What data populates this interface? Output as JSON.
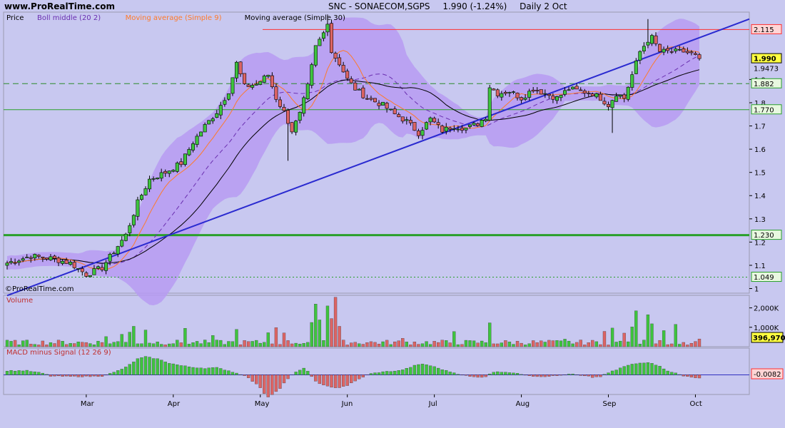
{
  "header": {
    "site": "www.ProRealTime.com",
    "symbol": "SNC - SONAECOM,SGPS",
    "quote": "1.990 (-1.24%)",
    "period": "Daily  2 Oct"
  },
  "colors": {
    "background": "#c8c8f0",
    "band": "#b79bf2",
    "up": "#3ec43e",
    "down": "#dc6464",
    "ma9": "#ff7a2a",
    "ma30": "#000000",
    "boll": "#6a2fb0",
    "trend": "#2a2ad0",
    "resistance": "#ff3030",
    "support": "#2aa02a"
  },
  "chart_data": [
    {
      "type": "candlestick",
      "legend": [
        {
          "name": "Price",
          "color": "#000000"
        },
        {
          "name": "Boll middle (20 2)",
          "color": "#6a2fb0"
        },
        {
          "name": "Moving average (Simple 9)",
          "color": "#ff7a2a"
        },
        {
          "name": "Moving average (Simple 30)",
          "color": "#000000"
        }
      ],
      "ylim": [
        0.98,
        2.19
      ],
      "y_ticks": [
        1,
        1.1,
        1.2,
        1.3,
        1.4,
        1.5,
        1.6,
        1.7,
        1.8,
        1.9
      ],
      "price_labels": [
        {
          "text": "2.115",
          "value": 2.115,
          "style": "resistance"
        },
        {
          "text": "1.990",
          "value": 1.99,
          "style": "current"
        },
        {
          "text": "1.9473",
          "value": 1.9473,
          "style": "plain"
        },
        {
          "text": "1.882",
          "value": 1.882,
          "style": "support"
        },
        {
          "text": "1.770",
          "value": 1.77,
          "style": "support"
        },
        {
          "text": "1.230",
          "value": 1.23,
          "style": "support"
        },
        {
          "text": "1.049",
          "value": 1.049,
          "style": "support"
        }
      ],
      "horizontal_lines": [
        {
          "value": 2.115,
          "kind": "solid-red"
        },
        {
          "value": 1.882,
          "kind": "dashed-green"
        },
        {
          "value": 1.77,
          "kind": "solid-green-thin"
        },
        {
          "value": 1.23,
          "kind": "solid-green-thick"
        },
        {
          "value": 1.049,
          "kind": "dotted-green"
        }
      ],
      "trendline": {
        "from": {
          "x": 0,
          "y": 0.97
        },
        "to": {
          "x": 175,
          "y": 2.08
        }
      },
      "months": [
        {
          "label": "Mar",
          "x": 20
        },
        {
          "label": "Apr",
          "x": 42
        },
        {
          "label": "May",
          "x": 64
        },
        {
          "label": "Jun",
          "x": 86
        },
        {
          "label": "Jul",
          "x": 108
        },
        {
          "label": "Aug",
          "x": 130
        },
        {
          "label": "Sep",
          "x": 152
        },
        {
          "label": "Oct",
          "x": 174
        }
      ],
      "close_anchors": [
        [
          0,
          1.11
        ],
        [
          6,
          1.14
        ],
        [
          11,
          1.13
        ],
        [
          16,
          1.11
        ],
        [
          20,
          1.06
        ],
        [
          24,
          1.09
        ],
        [
          27,
          1.16
        ],
        [
          30,
          1.23
        ],
        [
          33,
          1.37
        ],
        [
          36,
          1.47
        ],
        [
          40,
          1.5
        ],
        [
          44,
          1.54
        ],
        [
          47,
          1.63
        ],
        [
          50,
          1.7
        ],
        [
          53,
          1.76
        ],
        [
          56,
          1.85
        ],
        [
          58,
          1.97
        ],
        [
          60,
          1.87
        ],
        [
          63,
          1.88
        ],
        [
          66,
          1.92
        ],
        [
          68,
          1.82
        ],
        [
          70,
          1.76
        ],
        [
          72,
          1.68
        ],
        [
          74,
          1.75
        ],
        [
          76,
          1.87
        ],
        [
          78,
          2.04
        ],
        [
          80,
          2.1
        ],
        [
          81,
          2.15
        ],
        [
          82,
          2.02
        ],
        [
          84,
          1.97
        ],
        [
          86,
          1.9
        ],
        [
          88,
          1.86
        ],
        [
          91,
          1.82
        ],
        [
          95,
          1.79
        ],
        [
          98,
          1.75
        ],
        [
          101,
          1.72
        ],
        [
          104,
          1.67
        ],
        [
          107,
          1.73
        ],
        [
          110,
          1.68
        ],
        [
          113,
          1.7
        ],
        [
          116,
          1.69
        ],
        [
          119,
          1.71
        ],
        [
          121,
          1.74
        ],
        [
          122,
          1.87
        ],
        [
          124,
          1.84
        ],
        [
          127,
          1.85
        ],
        [
          130,
          1.82
        ],
        [
          133,
          1.86
        ],
        [
          136,
          1.84
        ],
        [
          139,
          1.82
        ],
        [
          142,
          1.86
        ],
        [
          145,
          1.85
        ],
        [
          148,
          1.84
        ],
        [
          150,
          1.82
        ],
        [
          152,
          1.79
        ],
        [
          154,
          1.84
        ],
        [
          156,
          1.82
        ],
        [
          158,
          1.92
        ],
        [
          160,
          2.02
        ],
        [
          162,
          2.07
        ],
        [
          163,
          2.08
        ],
        [
          165,
          2.02
        ],
        [
          168,
          2.02
        ],
        [
          171,
          2.02
        ],
        [
          173,
          2.01
        ],
        [
          175,
          1.99
        ]
      ],
      "volume": {
        "label": "Volume",
        "ticks": [
          {
            "text": "2,000K",
            "value": 2000
          },
          {
            "text": "1,000K",
            "value": 1000
          }
        ],
        "last_label": "396,970",
        "ymax": 2500,
        "spikes": [
          [
            25,
            520
          ],
          [
            29,
            640
          ],
          [
            31,
            750
          ],
          [
            32,
            1050
          ],
          [
            35,
            860
          ],
          [
            45,
            950
          ],
          [
            52,
            580
          ],
          [
            58,
            890
          ],
          [
            66,
            720
          ],
          [
            68,
            980
          ],
          [
            70,
            710
          ],
          [
            77,
            1250
          ],
          [
            78,
            2200
          ],
          [
            79,
            1380
          ],
          [
            81,
            2100
          ],
          [
            82,
            1450
          ],
          [
            83,
            2550
          ],
          [
            84,
            1050
          ],
          [
            100,
            430
          ],
          [
            113,
            780
          ],
          [
            122,
            1230
          ],
          [
            141,
            390
          ],
          [
            151,
            790
          ],
          [
            153,
            960
          ],
          [
            156,
            700
          ],
          [
            158,
            1020
          ],
          [
            159,
            1850
          ],
          [
            162,
            1650
          ],
          [
            163,
            1180
          ],
          [
            166,
            830
          ],
          [
            169,
            1150
          ],
          [
            175,
            400
          ]
        ]
      },
      "macd": {
        "label": "MACD minus Signal (12 26 9)",
        "last_label": "-0.0082",
        "ylim": [
          -0.055,
          0.055
        ],
        "anchors": [
          [
            0,
            0.01
          ],
          [
            5,
            0.01
          ],
          [
            9,
            0.004
          ],
          [
            11,
            -0.003
          ],
          [
            16,
            -0.004
          ],
          [
            20,
            -0.004
          ],
          [
            24,
            -0.003
          ],
          [
            27,
            0.006
          ],
          [
            30,
            0.018
          ],
          [
            33,
            0.038
          ],
          [
            35,
            0.043
          ],
          [
            38,
            0.038
          ],
          [
            41,
            0.028
          ],
          [
            44,
            0.022
          ],
          [
            47,
            0.018
          ],
          [
            50,
            0.016
          ],
          [
            53,
            0.017
          ],
          [
            56,
            0.01
          ],
          [
            58,
            0.004
          ],
          [
            60,
            -0.001
          ],
          [
            62,
            -0.015
          ],
          [
            64,
            -0.03
          ],
          [
            65,
            -0.044
          ],
          [
            66,
            -0.052
          ],
          [
            67,
            -0.046
          ],
          [
            68,
            -0.04
          ],
          [
            69,
            -0.032
          ],
          [
            70,
            -0.02
          ],
          [
            71,
            -0.01
          ],
          [
            72,
            0.0
          ],
          [
            74,
            0.012
          ],
          [
            75,
            0.016
          ],
          [
            76,
            0.008
          ],
          [
            77,
            -0.005
          ],
          [
            78,
            -0.015
          ],
          [
            80,
            -0.025
          ],
          [
            82,
            -0.03
          ],
          [
            84,
            -0.03
          ],
          [
            86,
            -0.025
          ],
          [
            88,
            -0.015
          ],
          [
            90,
            -0.005
          ],
          [
            92,
            0.003
          ],
          [
            94,
            0.006
          ],
          [
            96,
            0.008
          ],
          [
            99,
            0.01
          ],
          [
            101,
            0.015
          ],
          [
            103,
            0.022
          ],
          [
            105,
            0.026
          ],
          [
            107,
            0.022
          ],
          [
            109,
            0.016
          ],
          [
            111,
            0.01
          ],
          [
            113,
            0.005
          ],
          [
            115,
            0.0
          ],
          [
            117,
            -0.004
          ],
          [
            119,
            -0.006
          ],
          [
            121,
            -0.004
          ],
          [
            122,
            0.003
          ],
          [
            124,
            0.008
          ],
          [
            127,
            0.006
          ],
          [
            129,
            0.003
          ],
          [
            131,
            0.0
          ],
          [
            133,
            -0.003
          ],
          [
            135,
            -0.004
          ],
          [
            137,
            -0.003
          ],
          [
            139,
            -0.002
          ],
          [
            141,
            0.0
          ],
          [
            143,
            0.002
          ],
          [
            145,
            -0.002
          ],
          [
            147,
            -0.004
          ],
          [
            148,
            -0.006
          ],
          [
            150,
            -0.004
          ],
          [
            152,
            0.005
          ],
          [
            154,
            0.012
          ],
          [
            156,
            0.02
          ],
          [
            158,
            0.025
          ],
          [
            160,
            0.028
          ],
          [
            162,
            0.03
          ],
          [
            163,
            0.028
          ],
          [
            165,
            0.02
          ],
          [
            167,
            0.01
          ],
          [
            169,
            0.004
          ],
          [
            171,
            -0.003
          ],
          [
            173,
            -0.005
          ],
          [
            175,
            -0.0082
          ]
        ]
      },
      "watermark": "©ProRealTime.com"
    }
  ]
}
